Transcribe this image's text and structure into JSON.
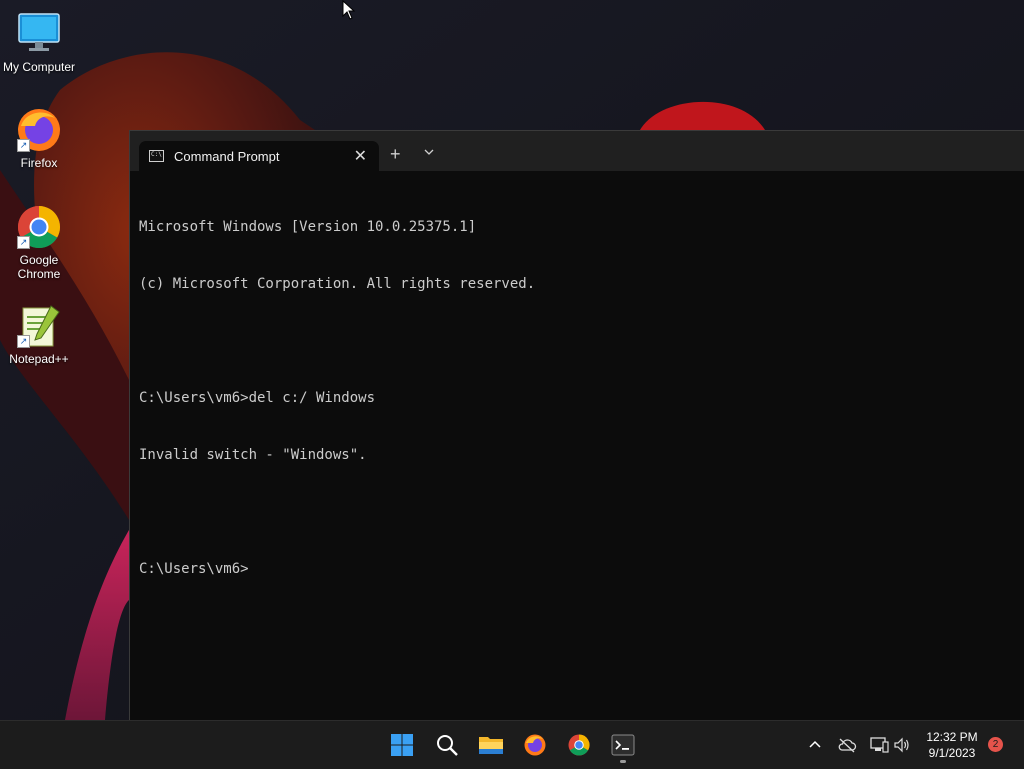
{
  "desktop": {
    "icons": [
      {
        "label": "My Computer",
        "icon": "monitor-icon"
      },
      {
        "label": "Firefox",
        "icon": "firefox-icon"
      },
      {
        "label": "Google Chrome",
        "icon": "chrome-icon"
      },
      {
        "label": "Notepad++",
        "icon": "notepadpp-icon"
      }
    ]
  },
  "terminal": {
    "tab_title": "Command Prompt",
    "close_glyph": "✕",
    "new_tab_glyph": "+",
    "lines": [
      "Microsoft Windows [Version 10.0.25375.1]",
      "(c) Microsoft Corporation. All rights reserved.",
      "",
      "C:\\Users\\vm6>del c:/ Windows",
      "Invalid switch - \"Windows\".",
      "",
      "C:\\Users\\vm6>"
    ]
  },
  "taskbar": {
    "pinned": [
      {
        "name": "start",
        "icon": "windows-start-icon"
      },
      {
        "name": "search",
        "icon": "search-icon"
      },
      {
        "name": "file-explorer",
        "icon": "folder-icon"
      },
      {
        "name": "firefox",
        "icon": "firefox-icon"
      },
      {
        "name": "chrome",
        "icon": "chrome-icon"
      },
      {
        "name": "terminal",
        "icon": "terminal-icon",
        "active": true
      }
    ],
    "tray": {
      "time": "12:32 PM",
      "date": "9/1/2023",
      "notification_count": "2"
    }
  },
  "colors": {
    "console_bg": "#0c0c0c",
    "console_text": "#cccccc",
    "taskbar_bg": "#1c1c1c",
    "notification_badge": "#e5534b"
  }
}
